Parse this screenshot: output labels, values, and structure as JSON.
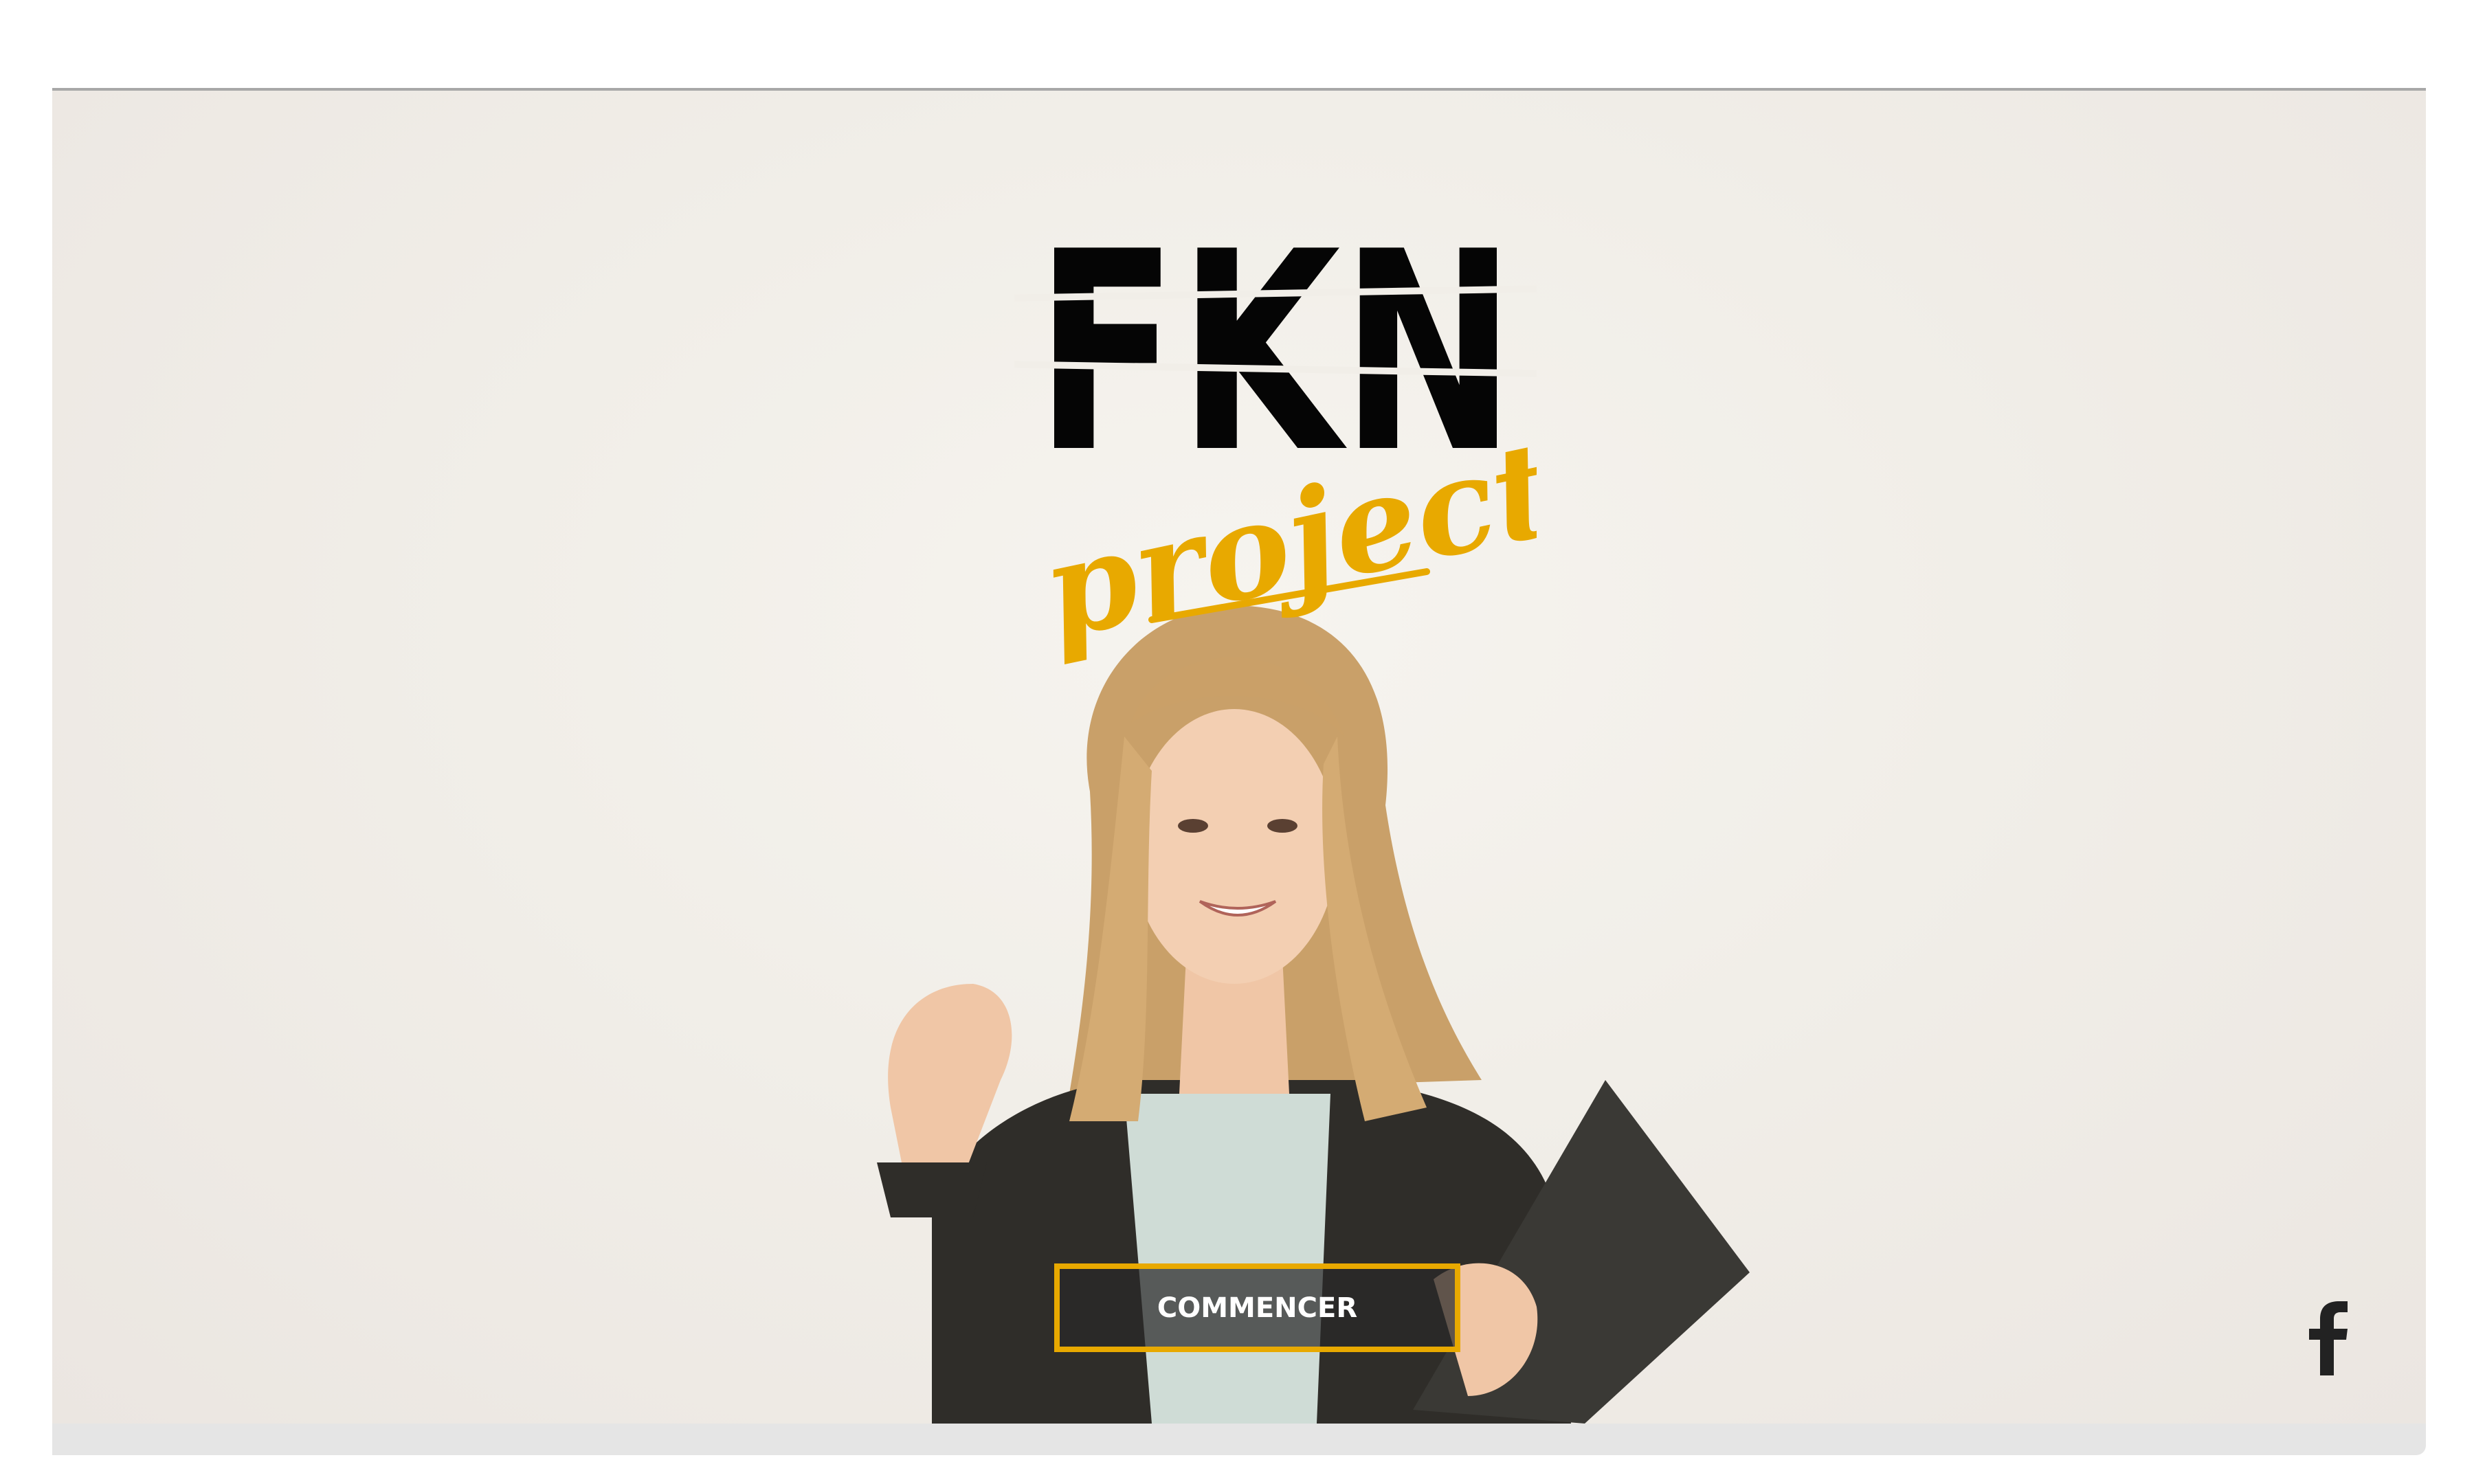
{
  "brand": {
    "logo_main": "FKN",
    "logo_script": "project",
    "accent_color": "#e8a900"
  },
  "hero": {
    "cta_label": "COMMENCER"
  },
  "social": {
    "facebook_icon": "facebook-icon"
  }
}
